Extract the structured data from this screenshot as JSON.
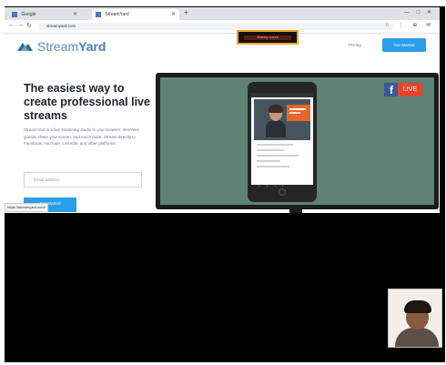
{
  "browser": {
    "tabs": [
      {
        "label": "Google"
      },
      {
        "label": "StreamYard"
      }
    ],
    "new_tab": "+",
    "window_controls": "— □ ✕",
    "address": "streamyard.com",
    "ext_icons": "☆ ⋮ ⊕ ✉",
    "nav_back": "←",
    "nav_forward": "→",
    "nav_reload": "↻"
  },
  "sharing_banner": "Sharing screen",
  "page": {
    "logo": {
      "part1": "Stream",
      "part2": "Yard"
    },
    "pricing_label": "Pricing",
    "cta_top": "Get Started",
    "hero_title": "The easiest way to create professional live streams",
    "hero_subtitle": "StreamYard is a live streaming studio in your browser. Interview guests, share your screen, and much more. Stream directly to Facebook, YouTube, LinkedIn, and other platforms.",
    "email_placeholder": "Email address",
    "hero_cta": "Get Started",
    "status_url": "https://streamyard.com/"
  },
  "badges": {
    "facebook": "f",
    "live": "LIVE"
  },
  "colors": {
    "accent": "#2a9ee8",
    "monitor_screen": "#5e8276",
    "live_red": "#e8442c",
    "facebook_blue": "#3b5998",
    "banner_border": "#f2a51f"
  }
}
